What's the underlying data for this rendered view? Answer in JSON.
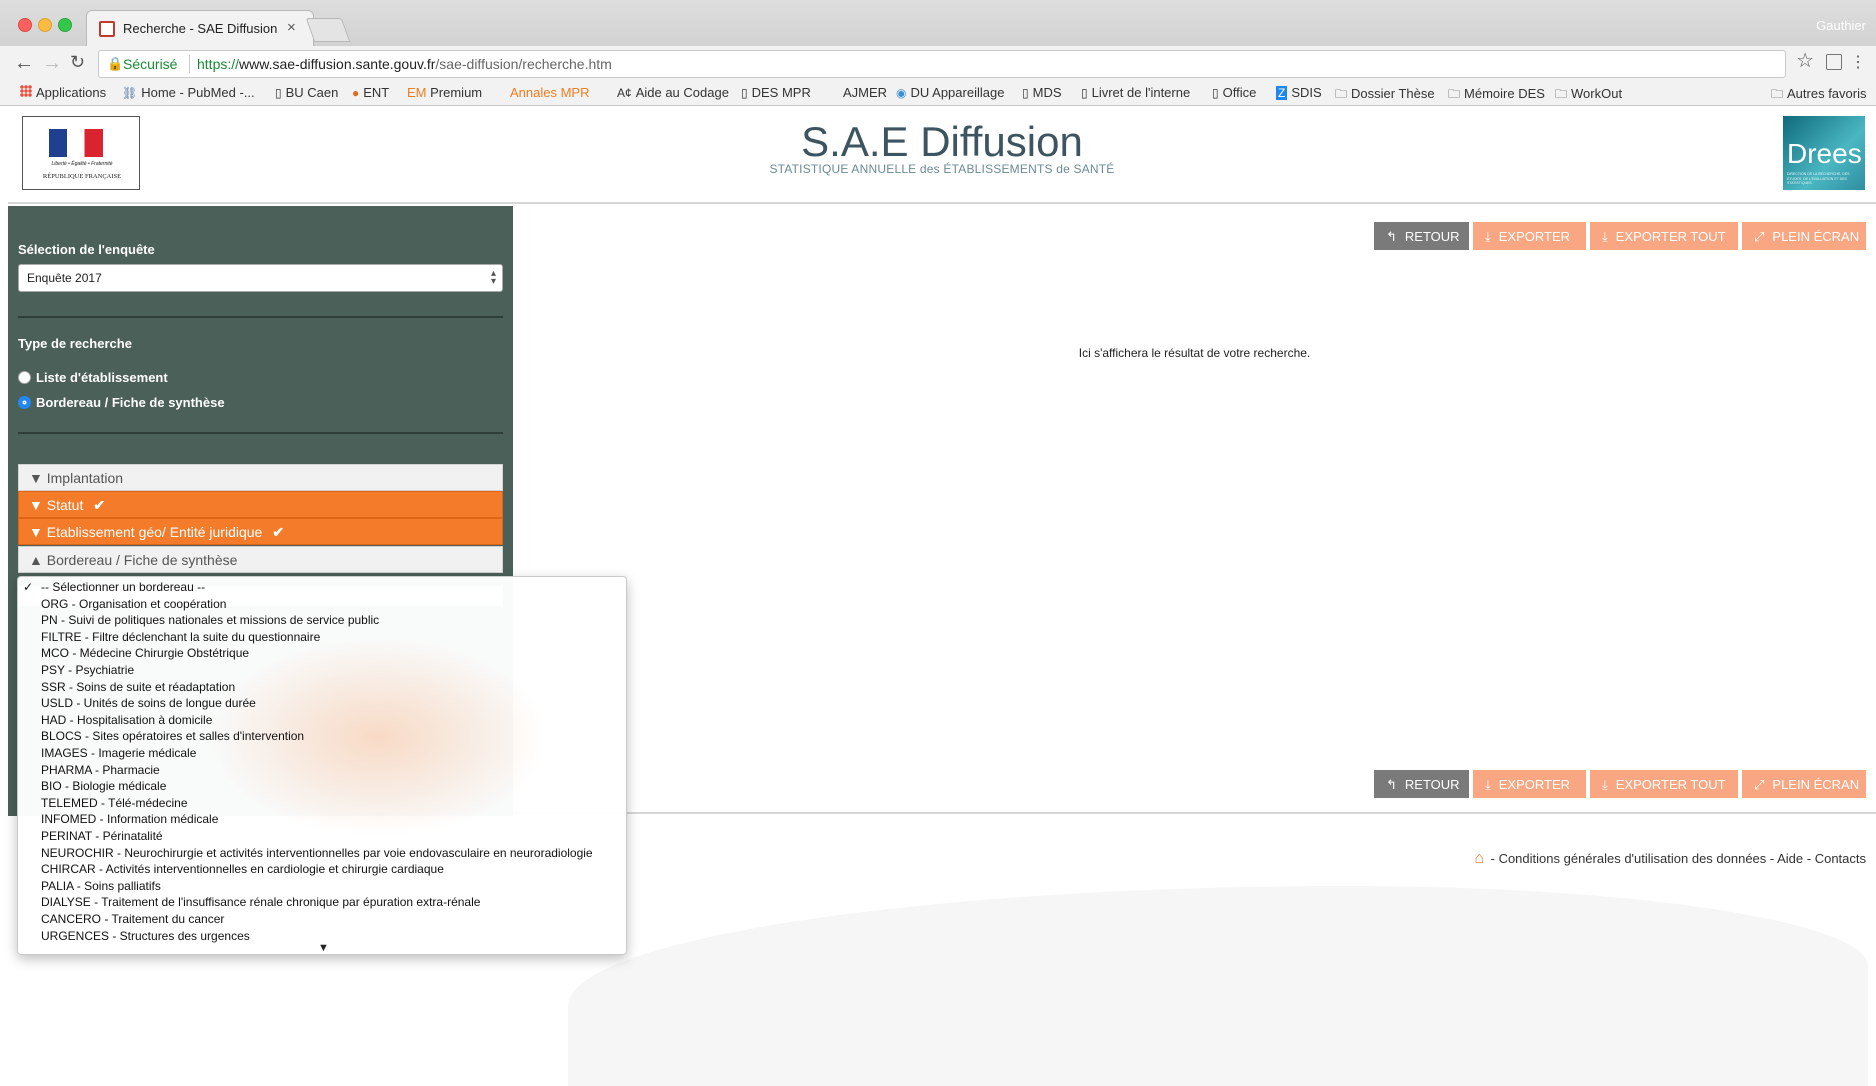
{
  "browser": {
    "tab_title": "Recherche - SAE Diffusion",
    "tab_close": "×",
    "profile": "Gauthier",
    "secure_label": "Sécurisé",
    "url_scheme": "https://",
    "url_host": "www.sae-diffusion.sante.gouv.fr",
    "url_path": "/sae-diffusion/recherche.htm",
    "bookmarks": [
      {
        "label": "Applications"
      },
      {
        "label": "Home - PubMed -..."
      },
      {
        "label": "BU Caen"
      },
      {
        "label": "ENT"
      },
      {
        "prefix": "EM",
        "label": "EM Premium"
      },
      {
        "prefix": "EM",
        "label": "Annales MPR"
      },
      {
        "label": "Aide au Codage"
      },
      {
        "label": "DES MPR"
      },
      {
        "label": "AJMER"
      },
      {
        "label": "DU Appareillage"
      },
      {
        "label": "MDS"
      },
      {
        "label": "Livret de l'interne"
      },
      {
        "label": "Office"
      },
      {
        "label": "SDIS"
      },
      {
        "label": "Dossier Thèse"
      },
      {
        "label": "Mémoire DES"
      },
      {
        "label": "WorkOut"
      },
      {
        "label": "Autres favoris"
      }
    ]
  },
  "header": {
    "title": "S.A.E Diffusion",
    "subtitle": "STATISTIQUE ANNUELLE des ÉTABLISSEMENTS de SANTÉ",
    "logo_left_motto": "Liberté • Égalité • Fraternité",
    "logo_left_name": "RÉPUBLIQUE FRANÇAISE",
    "logo_right": "Drees",
    "logo_right_small": "DIRECTION DE LA RECHERCHE, DES ÉTUDES, DE L'ÉVALUATION ET DES STATISTIQUES"
  },
  "sidebar": {
    "survey_label": "Sélection de l'enquête",
    "survey_value": "Enquête 2017",
    "search_type_label": "Type de recherche",
    "radios": [
      {
        "label": "Liste d'établissement",
        "checked": false
      },
      {
        "label": "Bordereau / Fiche de synthèse",
        "checked": true
      }
    ],
    "accordions": [
      {
        "label": "Implantation",
        "style": "grey",
        "arrow": "▼",
        "check": ""
      },
      {
        "label": "Statut",
        "style": "orange",
        "arrow": "▼",
        "check": "✔"
      },
      {
        "label": "Etablissement géo/ Entité juridique",
        "style": "orange",
        "arrow": "▼",
        "check": "✔"
      },
      {
        "label": "Bordereau / Fiche de synthèse",
        "style": "grey",
        "arrow": "▲",
        "check": ""
      }
    ]
  },
  "main": {
    "buttons": [
      {
        "label": "RETOUR",
        "icon": "↰",
        "style": "grey"
      },
      {
        "label": "EXPORTER",
        "icon": "⤓",
        "style": "orange"
      },
      {
        "label": "EXPORTER TOUT",
        "icon": "⤓",
        "style": "orange"
      },
      {
        "label": "PLEIN ÉCRAN",
        "icon": "⤢",
        "style": "orange"
      }
    ],
    "result_message": "Ici s'affichera le résultat de votre recherche.",
    "footer": " - Conditions générales d'utilisation des données - Aide - Contacts"
  },
  "dropdown": {
    "selected_index": 0,
    "checkmark": "✓",
    "more_indicator": "▼",
    "options": [
      "-- Sélectionner un bordereau --",
      "ORG - Organisation et coopération",
      "PN - Suivi de politiques nationales et missions de service public",
      "FILTRE - Filtre déclenchant la suite du questionnaire",
      "MCO - Médecine Chirurgie Obstétrique",
      "PSY - Psychiatrie",
      "SSR - Soins de suite et réadaptation",
      "USLD - Unités de soins de longue durée",
      "HAD - Hospitalisation à domicile",
      "BLOCS - Sites opératoires et salles d'intervention",
      "IMAGES - Imagerie médicale",
      "PHARMA - Pharmacie",
      "BIO - Biologie médicale",
      "TELEMED - Télé-médecine",
      "INFOMED - Information médicale",
      "PERINAT - Périnatalité",
      "NEUROCHIR - Neurochirurgie et activités interventionnelles par voie endovasculaire en neuroradiologie",
      "CHIRCAR - Activités interventionnelles en cardiologie et chirurgie cardiaque",
      "PALIA - Soins palliatifs",
      "DIALYSE - Traitement de l'insuffisance rénale chronique par épuration extra-rénale",
      "CANCERO - Traitement du cancer",
      "URGENCES - Structures des urgences"
    ]
  }
}
